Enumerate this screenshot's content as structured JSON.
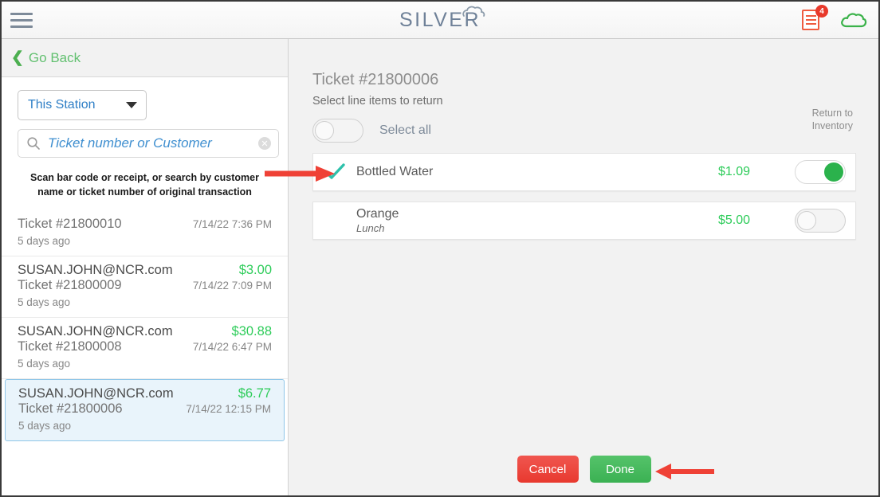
{
  "header": {
    "menu_icon": "hamburger-icon",
    "logo_text": "SILVER",
    "logo_cloud_icon": "cloud-icon",
    "receipt_icon": "receipt-icon",
    "receipt_badge": "4",
    "cloud_status_icon": "cloud-icon"
  },
  "sidebar": {
    "go_back_label": "Go Back",
    "back_icon": "chevron-left-icon",
    "station_filter": {
      "value": "This Station",
      "caret_icon": "chevron-down-icon"
    },
    "search": {
      "icon": "search-icon",
      "placeholder": "Ticket number or Customer",
      "value": "",
      "clear_icon": "close-circle-icon"
    },
    "hint_line_1": "Scan bar code or receipt, or search by customer",
    "hint_line_2": "name or ticket number of original transaction",
    "tickets": [
      {
        "email": "",
        "amount": "",
        "ticket": "Ticket #21800010",
        "date": "7/14/22 7:36 PM",
        "ago": "5 days ago",
        "selected": false
      },
      {
        "email": "SUSAN.JOHN@NCR.com",
        "amount": "$3.00",
        "ticket": "Ticket #21800009",
        "date": "7/14/22 7:09 PM",
        "ago": "5 days ago",
        "selected": false
      },
      {
        "email": "SUSAN.JOHN@NCR.com",
        "amount": "$30.88",
        "ticket": "Ticket #21800008",
        "date": "7/14/22 6:47 PM",
        "ago": "5 days ago",
        "selected": false
      },
      {
        "email": "SUSAN.JOHN@NCR.com",
        "amount": "$6.77",
        "ticket": "Ticket #21800006",
        "date": "7/14/22 12:15 PM",
        "ago": "5 days ago",
        "selected": true
      }
    ]
  },
  "main": {
    "title": "Ticket #21800006",
    "subtitle": "Select line items to return",
    "select_all_label": "Select all",
    "select_all_on": false,
    "return_to_inventory_line_1": "Return to",
    "return_to_inventory_line_2": "Inventory",
    "line_items": [
      {
        "name": "Bottled Water",
        "modifier": "",
        "price": "$1.09",
        "selected": true,
        "return_to_inventory": true,
        "check_icon": "check-icon"
      },
      {
        "name": "Orange",
        "modifier": "Lunch",
        "price": "$5.00",
        "selected": false,
        "return_to_inventory": false,
        "check_icon": "check-icon"
      }
    ],
    "cancel_label": "Cancel",
    "done_label": "Done"
  },
  "annotations": {
    "arrow_to_check": "arrow-right-icon",
    "arrow_to_done": "arrow-left-icon",
    "arrow_color": "#ef4136"
  },
  "colors": {
    "accent_green": "#2ecc5a",
    "link_blue": "#2f7fc6",
    "cancel_red": "#e8392f",
    "done_green": "#3bb153",
    "badge_red": "#e8392b",
    "receipt_orange": "#ef5b3f"
  }
}
